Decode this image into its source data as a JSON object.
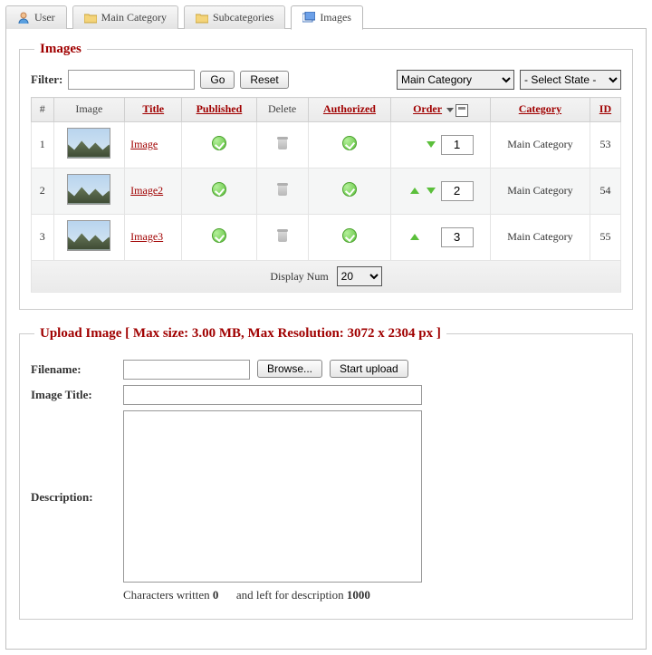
{
  "tabs": [
    {
      "label": "User",
      "icon": "user"
    },
    {
      "label": "Main Category",
      "icon": "folder"
    },
    {
      "label": "Subcategories",
      "icon": "folder"
    },
    {
      "label": "Images",
      "icon": "images",
      "active": true
    }
  ],
  "images_section": {
    "legend": "Images",
    "filter_label": "Filter:",
    "go": "Go",
    "reset": "Reset",
    "category_select": "Main Category",
    "state_select": "- Select State -",
    "headers": {
      "num": "#",
      "image": "Image",
      "title": "Title",
      "published": "Published",
      "delete": "Delete",
      "authorized": "Authorized",
      "order": "Order",
      "category": "Category",
      "id": "ID"
    },
    "rows": [
      {
        "num": "1",
        "title": "Image",
        "order": "1",
        "category": "Main Category",
        "id": "53",
        "up": false,
        "down": true
      },
      {
        "num": "2",
        "title": "Image2",
        "order": "2",
        "category": "Main Category",
        "id": "54",
        "up": true,
        "down": true
      },
      {
        "num": "3",
        "title": "Image3",
        "order": "3",
        "category": "Main Category",
        "id": "55",
        "up": true,
        "down": false
      }
    ],
    "display_num_label": "Display Num",
    "display_num_value": "20"
  },
  "upload_section": {
    "legend": "Upload Image [ Max size: 3.00 MB, Max Resolution: 3072 x 2304 px ]",
    "filename_label": "Filename:",
    "browse": "Browse...",
    "start_upload": "Start upload",
    "title_label": "Image Title:",
    "desc_label": "Description:",
    "chars_written_text": "Characters written",
    "chars_written": "0",
    "chars_left_text": "and left for description",
    "chars_left": "1000"
  }
}
